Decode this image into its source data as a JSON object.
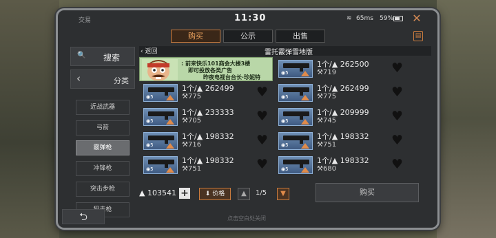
{
  "status": {
    "app_title": "交易",
    "time": "11:30",
    "ping": "65ms",
    "battery": "59%"
  },
  "tabs": [
    "购买",
    "公示",
    "出售"
  ],
  "active_tab": 0,
  "sidebar": {
    "search_label": "搜索",
    "category_label": "分类",
    "categories": [
      "近战武器",
      "弓箭",
      "霰弹枪",
      "冲锋枪",
      "突击步枪",
      "狙击枪"
    ],
    "active_category": 2
  },
  "main": {
    "back_label": "返回",
    "title": "雷托霰弹雪地版"
  },
  "ad": {
    "lines": [
      ": 前来快乐101商会大楼3楼",
      "即可投放各类广告",
      "昨夜电视台台长·珍妮特"
    ]
  },
  "items_left": [
    {
      "qty": "1个/",
      "price": "262499",
      "sub": "775"
    },
    {
      "qty": "1个/",
      "price": "233333",
      "sub": "705"
    },
    {
      "qty": "1个/",
      "price": "198332",
      "sub": "716"
    },
    {
      "qty": "1个/",
      "price": "198332",
      "sub": "751"
    }
  ],
  "items_right": [
    {
      "qty": "1个/",
      "price": "262500",
      "sub": "719"
    },
    {
      "qty": "1个/",
      "price": "262499",
      "sub": "775"
    },
    {
      "qty": "1个/",
      "price": "209999",
      "sub": "745"
    },
    {
      "qty": "1个/",
      "price": "198332",
      "sub": "751"
    },
    {
      "qty": "1个/",
      "price": "198332",
      "sub": "680"
    }
  ],
  "item_badge": "5",
  "bottom": {
    "money": "103541",
    "price_sort_label": "价格",
    "page": "1/5",
    "buy_label": "购买"
  },
  "hint": "点击空白处关闭",
  "colors": {
    "accent": "#c97b3e",
    "frame": "#2d2f31"
  }
}
